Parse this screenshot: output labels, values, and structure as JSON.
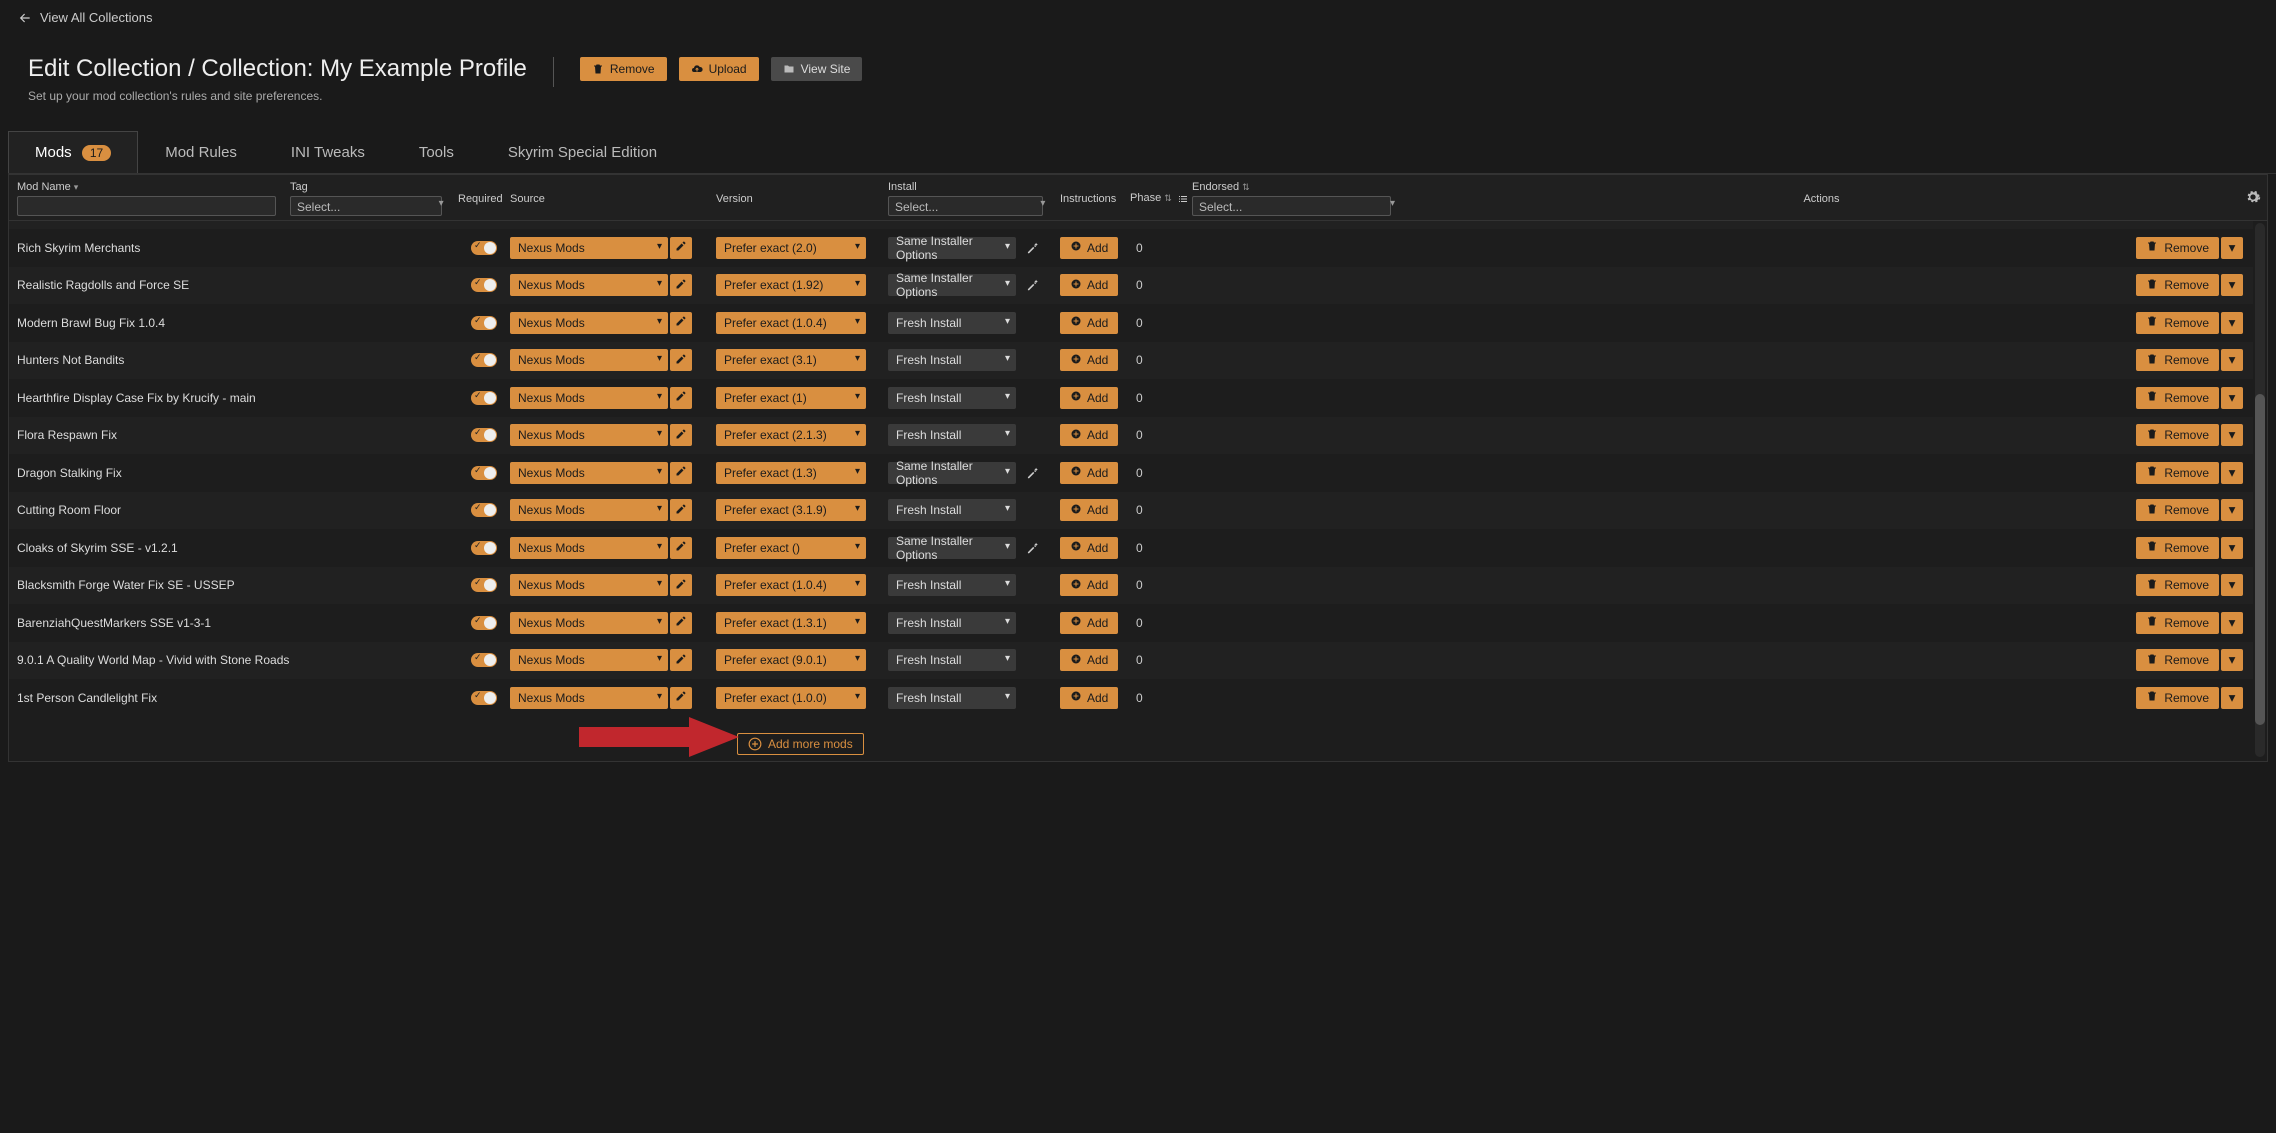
{
  "topbar": {
    "back_label": "View All Collections"
  },
  "header": {
    "title": "Edit Collection / Collection: My Example Profile",
    "subtitle": "Set up your mod collection's rules and site preferences.",
    "remove_label": "Remove",
    "upload_label": "Upload",
    "viewsite_label": "View Site"
  },
  "tabs": {
    "mods": "Mods",
    "mods_count": "17",
    "rules": "Mod Rules",
    "ini": "INI Tweaks",
    "tools": "Tools",
    "game": "Skyrim Special Edition"
  },
  "columns": {
    "mod_name": "Mod Name",
    "tag": "Tag",
    "required": "Required",
    "source": "Source",
    "version": "Version",
    "install": "Install",
    "instructions": "Instructions",
    "phase": "Phase",
    "endorsed": "Endorsed",
    "actions": "Actions"
  },
  "filters": {
    "tag_placeholder": "Select...",
    "install_placeholder": "Select...",
    "endorsed_placeholder": "Select..."
  },
  "labels": {
    "source_default": "Nexus Mods",
    "add": "Add",
    "remove": "Remove",
    "add_more": "Add more mods"
  },
  "rows": [
    {
      "name": "Rich Skyrim Merchants",
      "version": "Prefer exact (2.0)",
      "install": "Same Installer Options",
      "wand": true,
      "phase": "0"
    },
    {
      "name": "Realistic Ragdolls and Force SE",
      "version": "Prefer exact (1.92)",
      "install": "Same Installer Options",
      "wand": true,
      "phase": "0"
    },
    {
      "name": "Modern Brawl Bug Fix 1.0.4",
      "version": "Prefer exact (1.0.4)",
      "install": "Fresh Install",
      "wand": false,
      "phase": "0"
    },
    {
      "name": "Hunters Not Bandits",
      "version": "Prefer exact (3.1)",
      "install": "Fresh Install",
      "wand": false,
      "phase": "0"
    },
    {
      "name": "Hearthfire Display Case Fix by Krucify - main",
      "version": "Prefer exact (1)",
      "install": "Fresh Install",
      "wand": false,
      "phase": "0"
    },
    {
      "name": "Flora Respawn Fix",
      "version": "Prefer exact (2.1.3)",
      "install": "Fresh Install",
      "wand": false,
      "phase": "0"
    },
    {
      "name": "Dragon Stalking Fix",
      "version": "Prefer exact (1.3)",
      "install": "Same Installer Options",
      "wand": true,
      "phase": "0"
    },
    {
      "name": "Cutting Room Floor",
      "version": "Prefer exact (3.1.9)",
      "install": "Fresh Install",
      "wand": false,
      "phase": "0"
    },
    {
      "name": "Cloaks of Skyrim SSE - v1.2.1",
      "version": "Prefer exact ()",
      "install": "Same Installer Options",
      "wand": true,
      "phase": "0"
    },
    {
      "name": "Blacksmith Forge Water Fix SE - USSEP",
      "version": "Prefer exact (1.0.4)",
      "install": "Fresh Install",
      "wand": false,
      "phase": "0"
    },
    {
      "name": "BarenziahQuestMarkers SSE v1-3-1",
      "version": "Prefer exact (1.3.1)",
      "install": "Fresh Install",
      "wand": false,
      "phase": "0"
    },
    {
      "name": "9.0.1 A Quality World Map - Vivid with Stone Roads",
      "version": "Prefer exact (9.0.1)",
      "install": "Fresh Install",
      "wand": false,
      "phase": "0"
    },
    {
      "name": "1st Person Candlelight Fix",
      "version": "Prefer exact (1.0.0)",
      "install": "Fresh Install",
      "wand": false,
      "phase": "0"
    }
  ]
}
